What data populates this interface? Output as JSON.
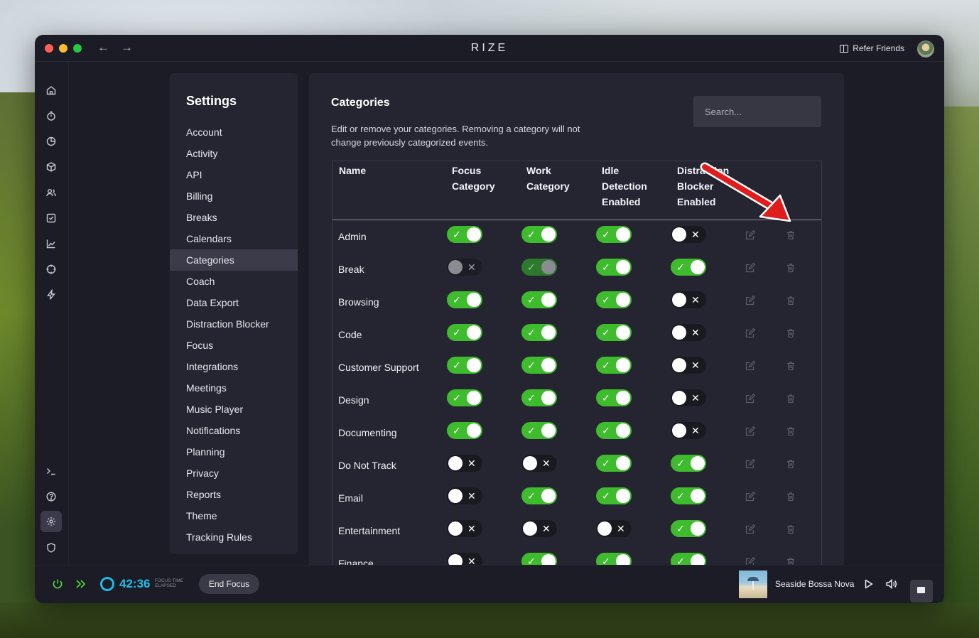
{
  "window": {
    "title": "RIZE",
    "nav_back": "←",
    "nav_forward": "→",
    "refer_label": "Refer Friends"
  },
  "sidebar_icons": [
    "home-icon",
    "timer-icon",
    "pie-chart-icon",
    "cube-icon",
    "users-icon",
    "checkbox-icon",
    "line-chart-icon",
    "crosshair-icon",
    "bolt-icon",
    "terminal-icon",
    "help-icon",
    "gear-icon",
    "shield-icon"
  ],
  "settings": {
    "title": "Settings",
    "items": [
      "Account",
      "Activity",
      "API",
      "Billing",
      "Breaks",
      "Calendars",
      "Categories",
      "Coach",
      "Data Export",
      "Distraction Blocker",
      "Focus",
      "Integrations",
      "Meetings",
      "Music Player",
      "Notifications",
      "Planning",
      "Privacy",
      "Reports",
      "Theme",
      "Tracking Rules"
    ],
    "active": "Categories"
  },
  "categories": {
    "title": "Categories",
    "description": "Edit or remove your categories. Removing a category will not change previously categorized events.",
    "search_placeholder": "Search...",
    "headers": {
      "name": "Name",
      "focus": [
        "Focus",
        "Category"
      ],
      "work": [
        "Work",
        "Category"
      ],
      "idle": [
        "Idle",
        "Detection",
        "Enabled"
      ],
      "distraction": [
        "Distraction",
        "Blocker",
        "Enabled"
      ]
    },
    "rows": [
      {
        "name": "Admin",
        "focus": "on",
        "work": "on",
        "idle": "on",
        "distraction": "off"
      },
      {
        "name": "Break",
        "focus": "dim-off",
        "work": "dim-on",
        "idle": "on",
        "distraction": "on"
      },
      {
        "name": "Browsing",
        "focus": "on",
        "work": "on",
        "idle": "on",
        "distraction": "off"
      },
      {
        "name": "Code",
        "focus": "on",
        "work": "on",
        "idle": "on",
        "distraction": "off"
      },
      {
        "name": "Customer Support",
        "focus": "on",
        "work": "on",
        "idle": "on",
        "distraction": "off"
      },
      {
        "name": "Design",
        "focus": "on",
        "work": "on",
        "idle": "on",
        "distraction": "off"
      },
      {
        "name": "Documenting",
        "focus": "on",
        "work": "on",
        "idle": "on",
        "distraction": "off"
      },
      {
        "name": "Do Not Track",
        "focus": "off",
        "work": "off",
        "idle": "on",
        "distraction": "on"
      },
      {
        "name": "Email",
        "focus": "off",
        "work": "on",
        "idle": "on",
        "distraction": "on"
      },
      {
        "name": "Entertainment",
        "focus": "off",
        "work": "off",
        "idle": "off",
        "distraction": "on"
      },
      {
        "name": "Finance",
        "focus": "off",
        "work": "on",
        "idle": "on",
        "distraction": "on"
      }
    ]
  },
  "footer": {
    "timer": "42:36",
    "timer_label": [
      "FOCUS TIME",
      "ELAPSED"
    ],
    "end_focus": "End Focus",
    "song": "Seaside Bossa Nova"
  },
  "colors": {
    "toggle_on": "#3fbc2d",
    "toggle_off": "#191920",
    "accent_timer": "#1fc0ee",
    "annotation_arrow": "#e01b1b"
  }
}
